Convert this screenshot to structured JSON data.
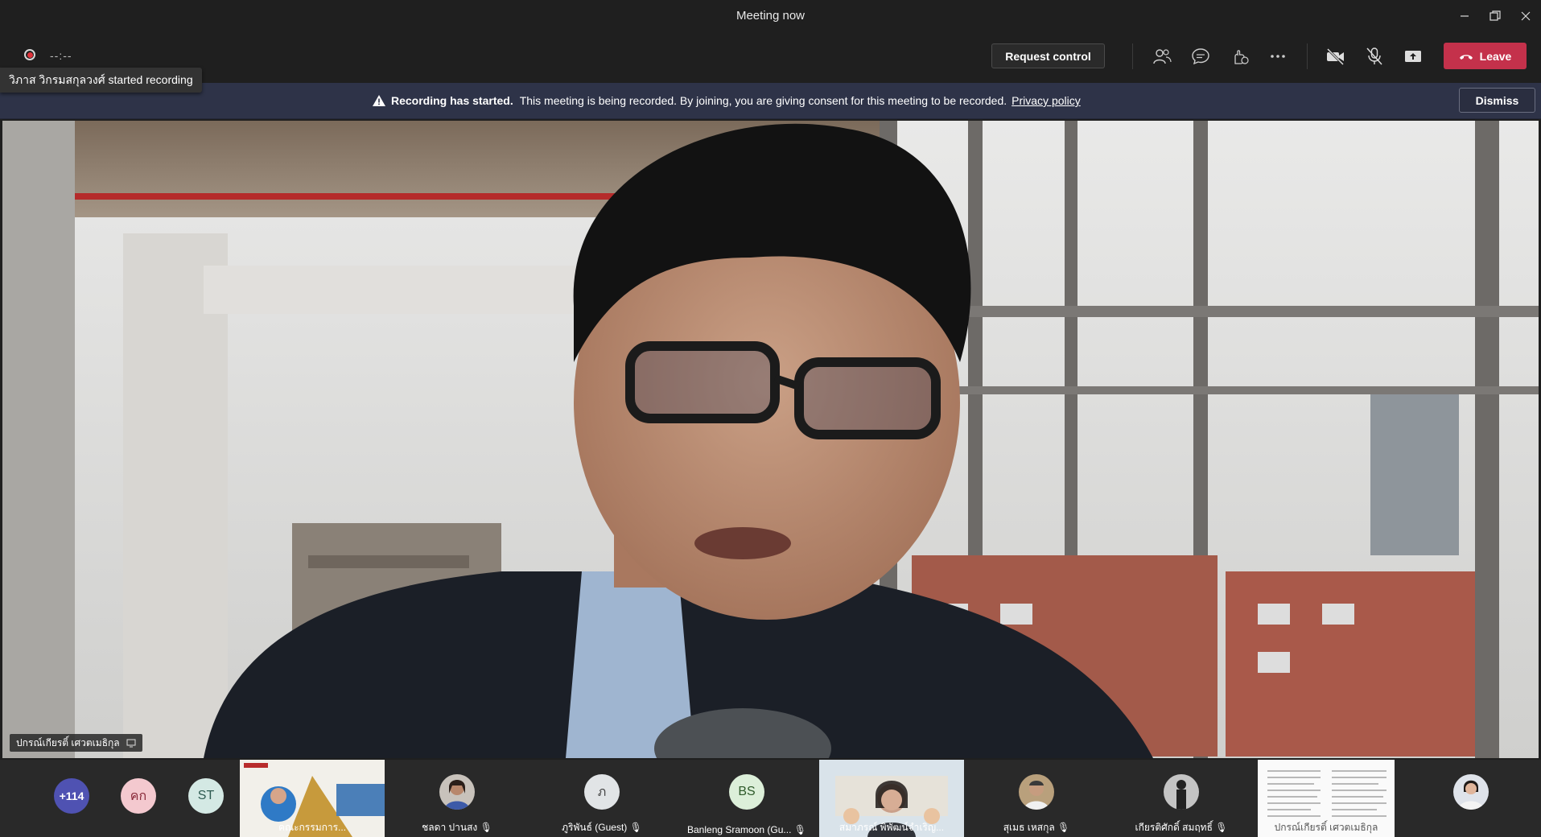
{
  "window": {
    "title": "Meeting now"
  },
  "toolbar": {
    "timer": "--:--",
    "request_control": "Request control",
    "leave": "Leave",
    "icons": [
      "participants-icon",
      "chat-icon",
      "reactions-icon",
      "more-icon",
      "camera-off-icon",
      "mic-off-icon",
      "share-icon"
    ]
  },
  "recording_toast": {
    "text": "วิภาส วิกรมสกุลวงศ์ started recording"
  },
  "banner": {
    "heading": "Recording has started.",
    "message": "This meeting is being recorded. By joining, you are giving consent for this meeting to be recorded.",
    "link": "Privacy policy",
    "dismiss": "Dismiss"
  },
  "main_video": {
    "speaker_name": "ปกรณ์เกียรติ์ เศวตเมธิกุล"
  },
  "participants": {
    "overflow_count": "+114",
    "avatars": [
      {
        "initials": "คก",
        "bg": "#f4c9cf",
        "fg": "#8a2b3a"
      },
      {
        "initials": "ST",
        "bg": "#d4e9e4",
        "fg": "#2f5b52"
      }
    ],
    "tiles": [
      {
        "name": "คณะกรรมการ...",
        "type": "video"
      },
      {
        "name": "ชลดา ปานสง",
        "type": "photo"
      },
      {
        "name": "ภูริพันธ์ (Guest)",
        "type": "initials",
        "initials": "ภ"
      },
      {
        "name": "Banleng Sramoon (Gu...",
        "type": "initials",
        "initials": "BS"
      },
      {
        "name": "สมาภรณ์ พิพัฒน์จำเริญ...",
        "type": "video"
      },
      {
        "name": "สุเมธ เหสกุล",
        "type": "photo"
      },
      {
        "name": "เกียรติศักดิ์ สมฤทธิ์",
        "type": "photo"
      },
      {
        "name": "ปกรณ์เกียรติ์ เศวตเมธิกุล",
        "type": "document"
      },
      {
        "name": "",
        "type": "photo"
      }
    ]
  }
}
